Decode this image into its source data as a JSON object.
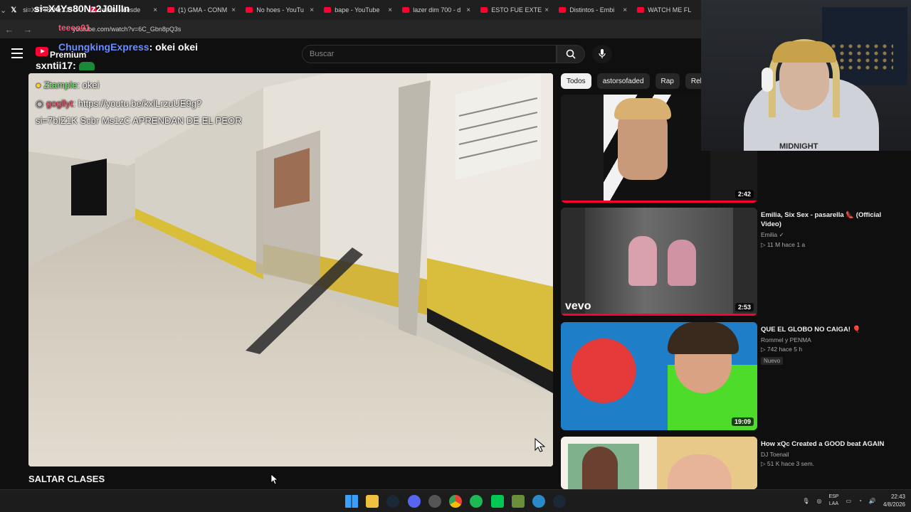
{
  "browser": {
    "tabs": [
      {
        "title": "si=X4Ys80Nz2J0illIn",
        "icon": "x-icon"
      },
      {
        "title": "media - desde",
        "icon": "youtube-icon"
      },
      {
        "title": "(1) GMA - CONM",
        "icon": "youtube-icon"
      },
      {
        "title": "No hoes - YouTu",
        "icon": "youtube-icon"
      },
      {
        "title": "bape - YouTube",
        "icon": "youtube-icon"
      },
      {
        "title": "lazer dim 700 - d",
        "icon": "youtube-icon"
      },
      {
        "title": "ESTO FUE EXTENS",
        "icon": "youtube-icon"
      },
      {
        "title": "Distintos - Embi",
        "icon": "youtube-icon"
      },
      {
        "title": "WATCH ME FL",
        "icon": "youtube-icon"
      }
    ],
    "url": "youtube.com/watch?v=6C_Gbn8pQ3s"
  },
  "youtube": {
    "premium_label": "Premium",
    "search_placeholder": "Buscar",
    "video_title": "SALTAR CLASES",
    "chips": [
      "Todos",
      "astorsofaded",
      "Rap",
      "Relaci"
    ],
    "recommendations": [
      {
        "title": "",
        "channel": "",
        "stats": "",
        "duration": "2:42",
        "badge": ""
      },
      {
        "title": "Emilia, Six Sex - pasarella 👠 (Official Video)",
        "channel": "Emilia ✓",
        "stats": "▷ 11 M  hace 1 a",
        "duration": "2:53",
        "badge": "",
        "brand": "vevo"
      },
      {
        "title": "QUE EL GLOBO NO CAIGA! 🎈",
        "channel": "Rommel y PENMA",
        "stats": "▷ 742  hace 5 h",
        "duration": "19:09",
        "badge": "Nuevo"
      },
      {
        "title": "How xQc Created a GOOD beat AGAIN",
        "channel": "DJ Toenail",
        "stats": "▷ 51 K  hace 3 sem.",
        "duration": "",
        "badge": ""
      }
    ]
  },
  "stream_chat": {
    "line0": "si=X4Ys80Nz2J0illIn",
    "line1_user": "teeeo01",
    "line2_user": "ChungkingExpress",
    "line2_msg": ": okei okei",
    "line3_user": "sxntii17",
    "line3_msg": ":",
    "overlay_user1": "Ztample",
    "overlay_msg1": ": okei",
    "overlay_user2": "gogllyt",
    "overlay_msg2": ": https://youtu.be/kxlLrzuUE9g?",
    "overlay_msg3": "si=7bIZ1K Scbr Ms1zC APRENDAN DE EL PEOR"
  },
  "taskbar": {
    "lang_top": "ESP",
    "lang_bottom": "LAA",
    "time": "22:43",
    "date": "4/8/2026"
  },
  "colors": {
    "youtube_red": "#ff0033",
    "bg": "#0f0f0f"
  }
}
